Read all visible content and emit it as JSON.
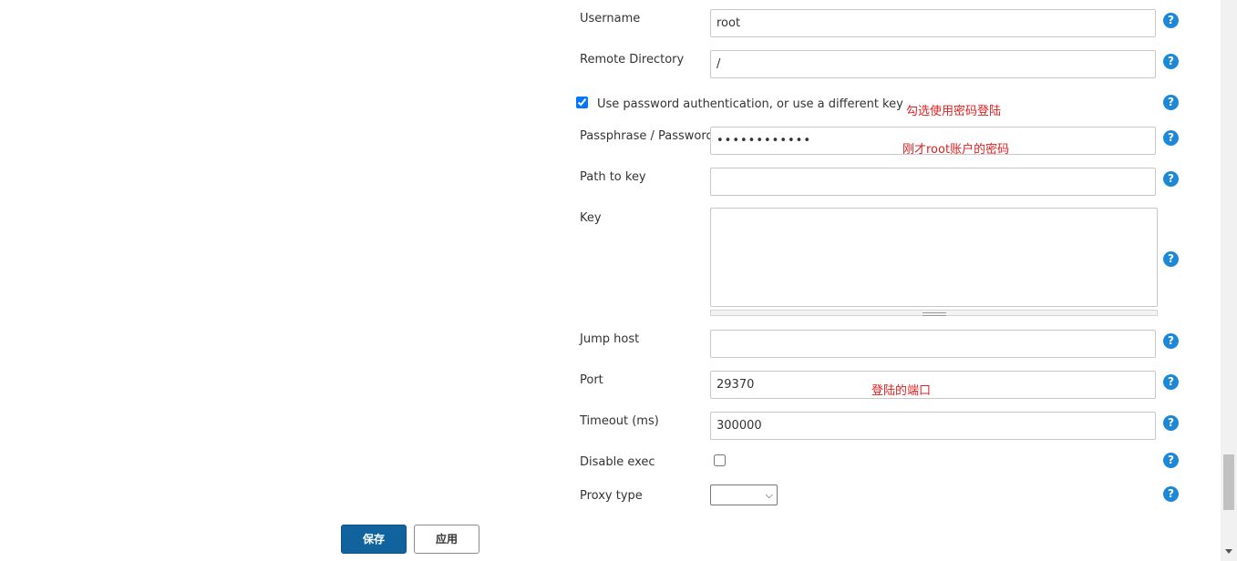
{
  "form": {
    "username": {
      "label": "Username",
      "value": "root"
    },
    "remote_directory": {
      "label": "Remote Directory",
      "value": "/"
    },
    "use_password_auth": {
      "label": "Use password authentication, or use a different key",
      "checked": true
    },
    "passphrase": {
      "label": "Passphrase / Password",
      "value": "••••••••••••"
    },
    "path_to_key": {
      "label": "Path to key",
      "value": ""
    },
    "key": {
      "label": "Key",
      "value": ""
    },
    "jump_host": {
      "label": "Jump host",
      "value": ""
    },
    "port": {
      "label": "Port",
      "value": "29370"
    },
    "timeout": {
      "label": "Timeout (ms)",
      "value": "300000"
    },
    "disable_exec": {
      "label": "Disable exec",
      "checked": false
    },
    "proxy_type": {
      "label": "Proxy type",
      "value": ""
    }
  },
  "annotations": {
    "use_password": "勾选使用密码登陆",
    "password": "刚才root账户的密码",
    "port": "登陆的端口"
  },
  "help_icon": "?",
  "buttons": {
    "save": "保存",
    "apply": "应用"
  },
  "colors": {
    "primary": "#11639d",
    "help": "#1e88d8",
    "annotation": "#e02020"
  }
}
